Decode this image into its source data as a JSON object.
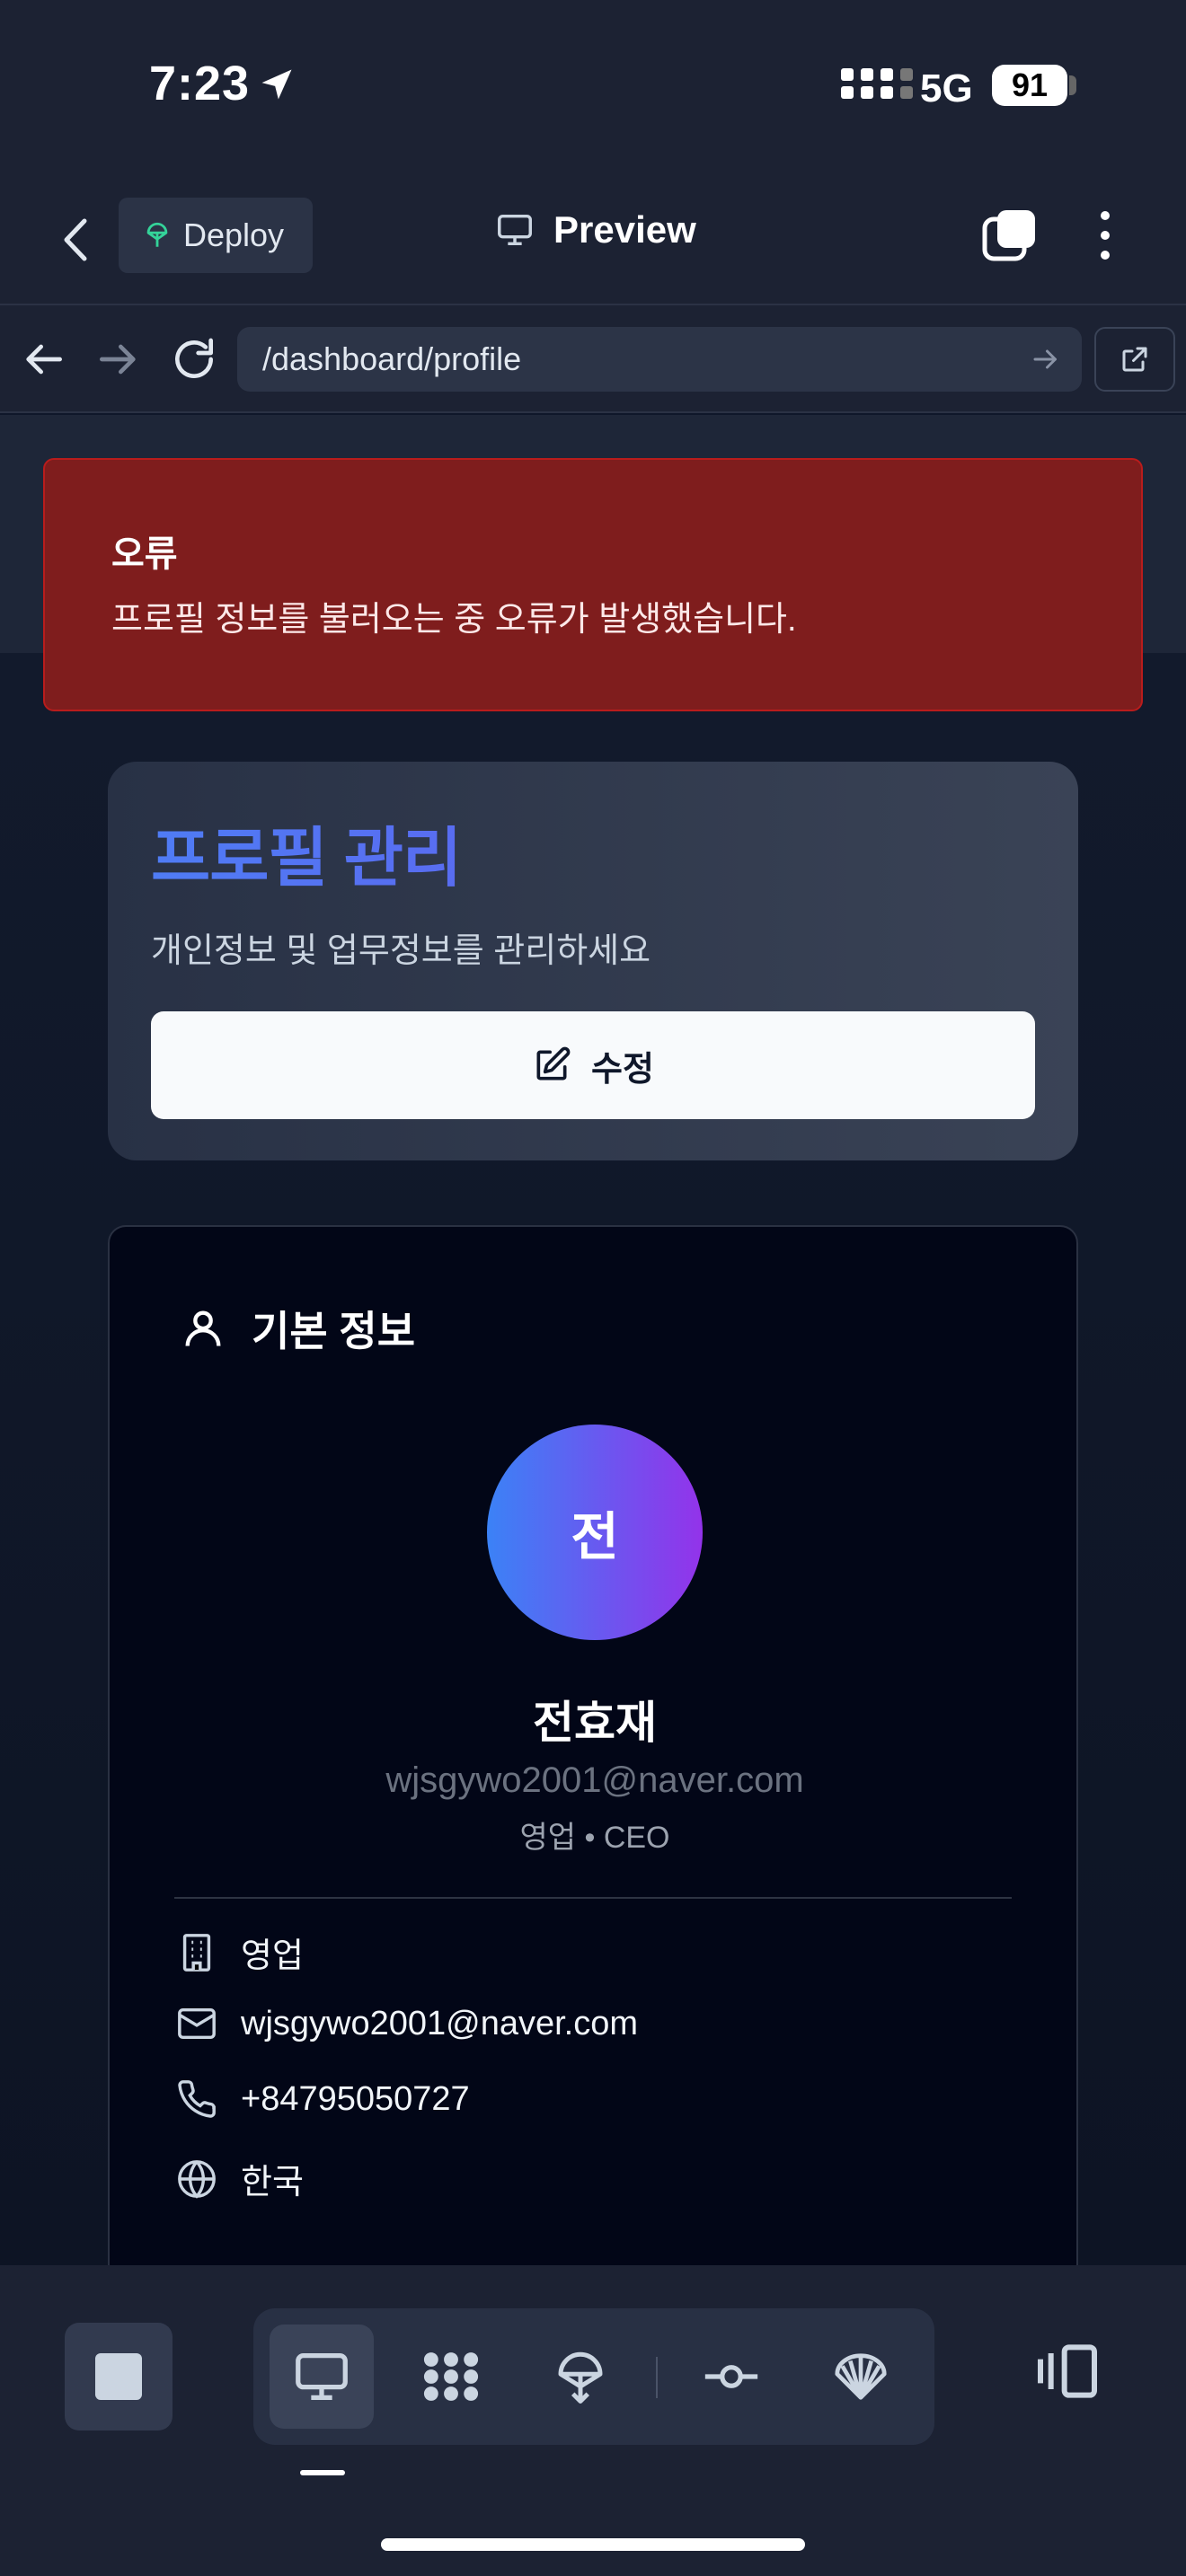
{
  "status_bar": {
    "time": "7:23",
    "network": "5G",
    "battery": "91"
  },
  "app_bar": {
    "deploy_label": "Deploy",
    "preview_label": "Preview"
  },
  "url_bar": {
    "url": "/dashboard/profile"
  },
  "error": {
    "title": "오류",
    "message": "프로필 정보를 불러오는 중 오류가 발생했습니다."
  },
  "header": {
    "title": "프로필 관리",
    "subtitle": "개인정보 및 업무정보를 관리하세요",
    "edit_label": "수정"
  },
  "basic_info": {
    "section_title": "기본 정보",
    "avatar_initial": "전",
    "name": "전효재",
    "email": "wjsgywo2001@naver.com",
    "role": "영업 • CEO",
    "details": [
      {
        "icon": "building-icon",
        "value": "영업"
      },
      {
        "icon": "mail-icon",
        "value": "wjsgywo2001@naver.com"
      },
      {
        "icon": "phone-icon",
        "value": "+84795050727"
      },
      {
        "icon": "globe-icon",
        "value": "한국"
      }
    ]
  },
  "toolbar": {
    "tools": [
      "desktop-icon",
      "apps-icon",
      "deploy-icon",
      "commit-icon",
      "shell-icon"
    ],
    "active_tool": "desktop-icon"
  },
  "colors": {
    "error_bg": "#7f1d1d",
    "accent_gradient_start": "#3b82f6",
    "accent_gradient_end": "#9333ea",
    "title_gradient_start": "#4f7cf5",
    "title_gradient_end": "#6b4fe8"
  }
}
